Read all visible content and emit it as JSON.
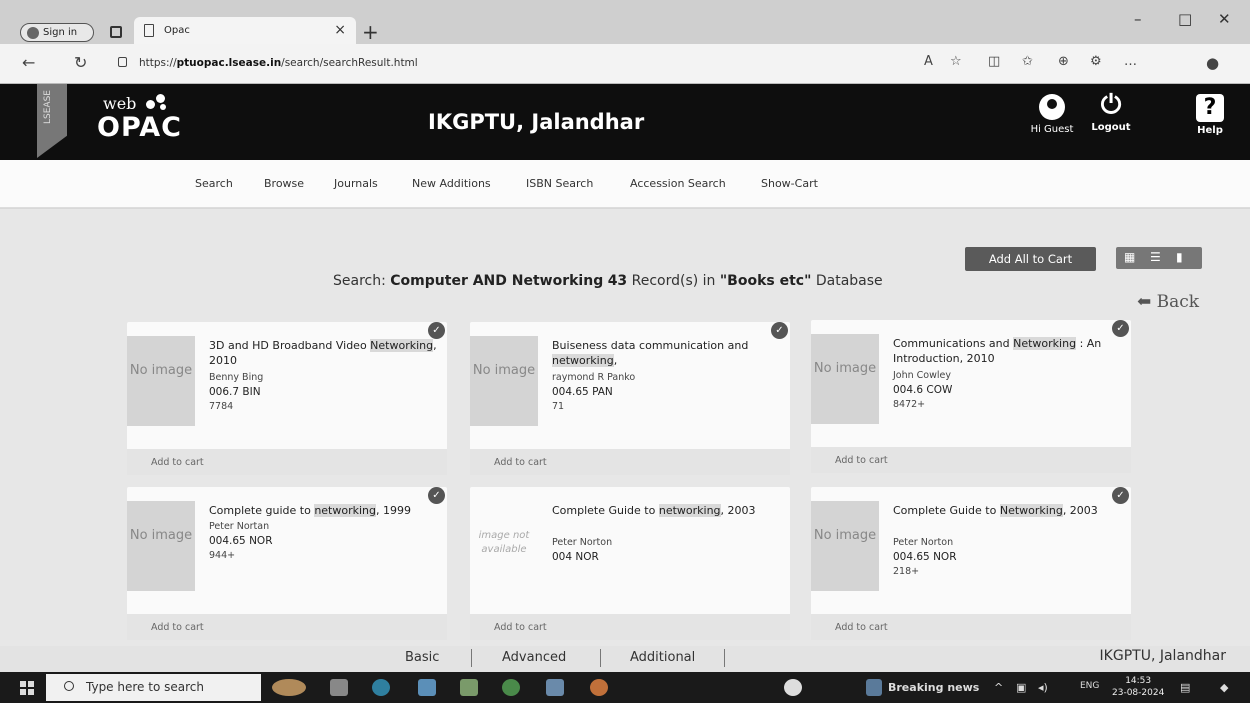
{
  "browser": {
    "signin_label": "Sign in",
    "tab_title": "Opac",
    "url_prefix": "https://",
    "url_host": "ptuopac.lsease.in",
    "url_path": "/search/searchResult.html"
  },
  "header": {
    "ribbon": "LSEASE",
    "logo_web": "web",
    "logo_opac": "OPAC",
    "institution": "IKGPTU, Jalandhar",
    "greeting": "Hi Guest",
    "logout_label": "Logout",
    "help_label": "Help"
  },
  "menu": [
    "Search",
    "Browse",
    "Journals",
    "New Additions",
    "ISBN Search",
    "Accession Search",
    "Show-Cart"
  ],
  "toolbar": {
    "add_all_label": "Add All to Cart",
    "back_label": "Back"
  },
  "search": {
    "prefix": "Search:",
    "query": "Computer AND Networking",
    "count": "43",
    "records_text": "Record(s) in",
    "database": "\"Books etc\"",
    "database_suffix": "Database"
  },
  "results": [
    {
      "title_pre": "3D and HD Broadband Video ",
      "highlight": "Networking",
      "title_post": ", 2010",
      "author": "Benny Bing",
      "call_no": "006.7 BIN",
      "acc": "7784",
      "image": "No image",
      "cart": "Add to cart"
    },
    {
      "title_pre": "Buiseness data communication and ",
      "highlight": "networking",
      "title_post": ",",
      "author": "raymond R Panko",
      "call_no": "004.65 PAN",
      "acc": "71",
      "image": "No image",
      "cart": "Add to cart"
    },
    {
      "title_pre": "Communications and ",
      "highlight": "Networking",
      "title_post": " : An Introduction, 2010",
      "author": "John Cowley",
      "call_no": "004.6 COW",
      "acc": "8472+",
      "image": "No image",
      "cart": "Add to cart"
    },
    {
      "title_pre": "Complete guide to ",
      "highlight": "networking",
      "title_post": ", 1999",
      "author": "Peter Nortan",
      "call_no": "004.65 NOR",
      "acc": "944+",
      "image": "No image",
      "cart": "Add to cart"
    },
    {
      "title_pre": "Complete Guide to ",
      "highlight": "networking",
      "title_post": ", 2003",
      "author": "Peter Norton",
      "call_no": "004 NOR",
      "acc": "",
      "image": "image not available",
      "cart": "Add to cart"
    },
    {
      "title_pre": "Complete Guide to ",
      "highlight": "Networking",
      "title_post": ", 2003",
      "author": "Peter Norton",
      "call_no": "004.65 NOR",
      "acc": "218+",
      "image": "No image",
      "cart": "Add to cart"
    }
  ],
  "footer": {
    "tabs": [
      "Basic",
      "Advanced",
      "Additional"
    ],
    "right": "IKGPTU, Jalandhar"
  },
  "taskbar": {
    "search_placeholder": "Type here to search",
    "news": "Breaking news",
    "lang": "ENG",
    "time": "14:53",
    "date": "23-08-2024"
  },
  "colors": {
    "header_bg": "#0e0e0e",
    "button_bg": "#5a5a5a",
    "content_bg": "#e7e7e7"
  }
}
